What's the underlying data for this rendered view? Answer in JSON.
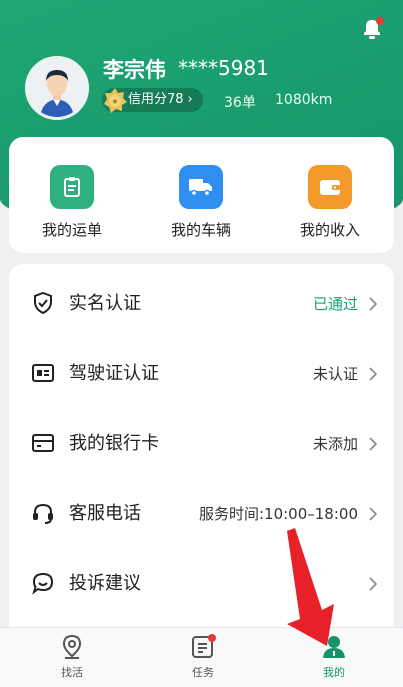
{
  "header": {
    "user_name": "李宗伟",
    "phone_masked": "****5981",
    "credit_label": "信用分78",
    "orders": "36单",
    "distance": "1080km"
  },
  "quick_actions": [
    {
      "label": "我的运单",
      "icon": "document-icon",
      "color": "#2fb080"
    },
    {
      "label": "我的车辆",
      "icon": "truck-icon",
      "color": "#2e8ff0"
    },
    {
      "label": "我的收入",
      "icon": "wallet-icon",
      "color": "#f39a2a"
    }
  ],
  "menu": [
    {
      "title": "实名认证",
      "status": "已通过",
      "icon": "shield-check-icon"
    },
    {
      "title": "驾驶证认证",
      "status": "未认证",
      "icon": "id-card-icon"
    },
    {
      "title": "我的银行卡",
      "status": "未添加",
      "icon": "bank-card-icon"
    },
    {
      "title": "客服电话",
      "status": "服务时间:10:00–18:00",
      "icon": "headset-icon"
    },
    {
      "title": "投诉建议",
      "status": "",
      "icon": "chat-icon"
    }
  ],
  "tabbar": [
    {
      "label": "找活",
      "icon": "location-pin-icon",
      "active": false
    },
    {
      "label": "任务",
      "icon": "task-list-icon",
      "active": false
    },
    {
      "label": "我的",
      "icon": "user-icon",
      "active": true
    }
  ],
  "colors": {
    "brand": "#169468",
    "accent_ok": "#1aa170",
    "badge": "#e53935"
  }
}
